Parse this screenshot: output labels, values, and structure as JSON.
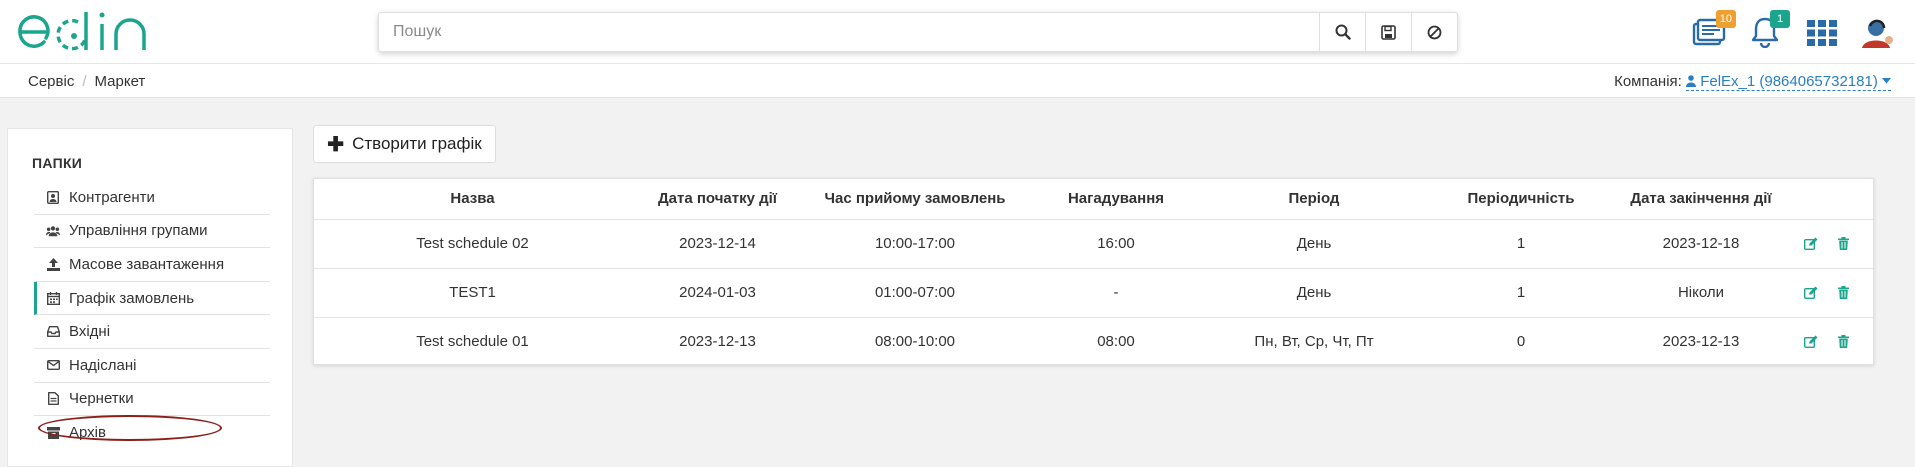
{
  "header": {
    "logo_text": "edin",
    "search": {
      "placeholder": "Пошук",
      "value": ""
    },
    "icons": {
      "documents": {
        "icon": "documents-icon",
        "badge": "10",
        "badge_color": "#f0a030"
      },
      "notifications": {
        "icon": "bell-icon",
        "badge": "1",
        "badge_color": "#1aa58c"
      },
      "apps": {
        "icon": "grid-apps-icon"
      },
      "user": {
        "icon": "user-avatar-icon"
      }
    }
  },
  "breadcrumb": {
    "items": [
      "Сервіс",
      "Маркет"
    ]
  },
  "company": {
    "label": "Компанія:",
    "value": "FelEx_1 (9864065732181)"
  },
  "sidebar": {
    "title": "ПАПКИ",
    "items": [
      {
        "label": "Контрагенти",
        "icon": "contacts-icon"
      },
      {
        "label": "Управління групами",
        "icon": "users-group-icon"
      },
      {
        "label": "Масове завантаження",
        "icon": "upload-icon"
      },
      {
        "label": "Графік замовлень",
        "icon": "calendar-icon",
        "active": true
      },
      {
        "label": "Вхідні",
        "icon": "inbox-icon"
      },
      {
        "label": "Надіслані",
        "icon": "envelope-icon"
      },
      {
        "label": "Чернетки",
        "icon": "draft-icon"
      },
      {
        "label": "Архів",
        "icon": "archive-icon"
      }
    ]
  },
  "toolbar": {
    "create_label": "Створити графік"
  },
  "table": {
    "headers": [
      "Назва",
      "Дата початку дії",
      "Час прийому замовлень",
      "Нагадування",
      "Період",
      "Періодичність",
      "Дата закінчення дії",
      ""
    ],
    "rows": [
      [
        "Test schedule 02",
        "2023-12-14",
        "10:00-17:00",
        "16:00",
        "День",
        "1",
        "2023-12-18"
      ],
      [
        "TEST1",
        "2024-01-03",
        "01:00-07:00",
        "-",
        "День",
        "1",
        "Ніколи"
      ],
      [
        "Test schedule 01",
        "2023-12-13",
        "08:00-10:00",
        "08:00",
        "Пн, Вт, Ср, Чт, Пт",
        "0",
        "2023-12-13"
      ]
    ]
  },
  "colors": {
    "accent": "#1aa58c",
    "link": "#2a7fc1",
    "highlight": "#8b1f1a"
  }
}
